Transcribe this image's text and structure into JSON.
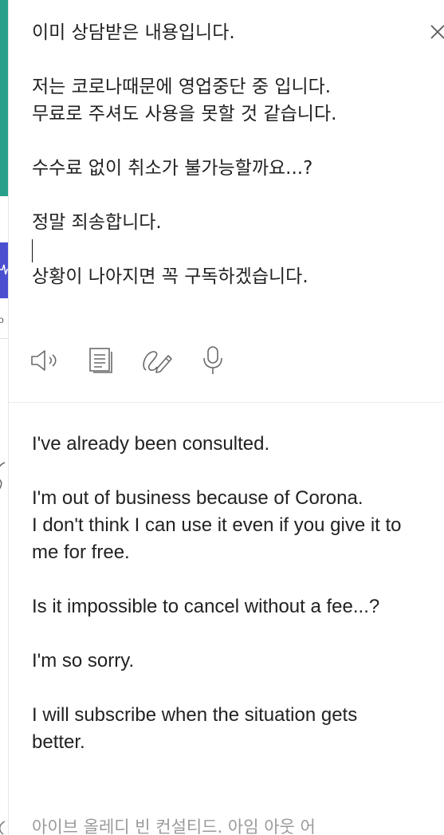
{
  "translator": {
    "source_text": "이미 상담받은 내용입니다.\n\n저는 코로나때문에 영업중단 중 입니다.\n무료로 주셔도 사용을 못할 것 같습니다.\n\n수수료 없이 취소가 불가능할까요...?\n\n정말 죄송합니다.\n\n상황이 나아지면 꼭 구독하겠습니다.",
    "translation_text": "I've already been consulted.\n\nI'm out of business because of Corona.\nI don't think I can use it even if you give it to me for free.\n\nIs it impossible to cancel without a fee...?\n\nI'm so sorry.\n\nI will subscribe when the situation gets better.",
    "romanization": "아이브 올레디 빈 컨설티드. 아임 아웃 어"
  },
  "background_page": {
    "letter": "o"
  },
  "icons": {
    "close": "close-icon",
    "listen": "speaker-icon",
    "copy": "copy-icon",
    "handwriting": "handwriting-icon",
    "voice": "microphone-icon"
  },
  "colors": {
    "accent_teal": "#27a08a",
    "accent_blue": "#4a4fd1",
    "icon_gray": "#6a6a6a"
  }
}
